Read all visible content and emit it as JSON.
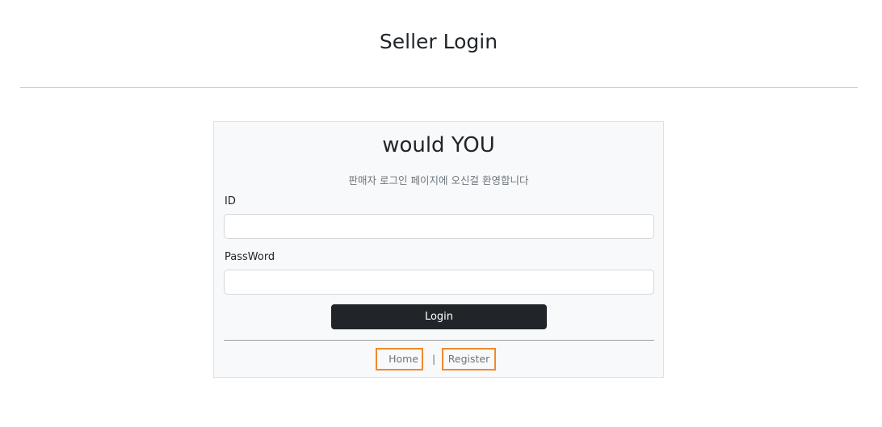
{
  "header": {
    "title": "Seller Login"
  },
  "card": {
    "brand": "would YOU",
    "welcome": "판매자 로그인 페이지에 오신걸 환영합니다",
    "id_field": {
      "label": "ID",
      "value": "",
      "placeholder": ""
    },
    "password_field": {
      "label": "PassWord",
      "value": "",
      "placeholder": ""
    },
    "login_button": "Login",
    "footer": {
      "home": "Home",
      "separator": "|",
      "register": "Register"
    }
  },
  "colors": {
    "button_bg": "#212529",
    "card_bg": "#f8f9fa",
    "highlight_border": "#f08a2c",
    "muted_text": "#6c757d"
  }
}
